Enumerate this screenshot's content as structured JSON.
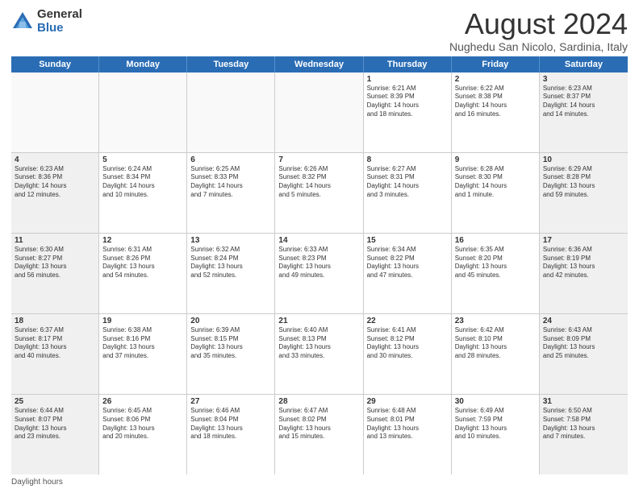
{
  "logo": {
    "general": "General",
    "blue": "Blue"
  },
  "title": "August 2024",
  "location": "Nughedu San Nicolo, Sardinia, Italy",
  "days": [
    "Sunday",
    "Monday",
    "Tuesday",
    "Wednesday",
    "Thursday",
    "Friday",
    "Saturday"
  ],
  "footer": {
    "daylight": "Daylight hours"
  },
  "weeks": [
    [
      {
        "day": "",
        "info": ""
      },
      {
        "day": "",
        "info": ""
      },
      {
        "day": "",
        "info": ""
      },
      {
        "day": "",
        "info": ""
      },
      {
        "day": "1",
        "info": "Sunrise: 6:21 AM\nSunset: 8:39 PM\nDaylight: 14 hours\nand 18 minutes."
      },
      {
        "day": "2",
        "info": "Sunrise: 6:22 AM\nSunset: 8:38 PM\nDaylight: 14 hours\nand 16 minutes."
      },
      {
        "day": "3",
        "info": "Sunrise: 6:23 AM\nSunset: 8:37 PM\nDaylight: 14 hours\nand 14 minutes."
      }
    ],
    [
      {
        "day": "4",
        "info": "Sunrise: 6:23 AM\nSunset: 8:36 PM\nDaylight: 14 hours\nand 12 minutes."
      },
      {
        "day": "5",
        "info": "Sunrise: 6:24 AM\nSunset: 8:34 PM\nDaylight: 14 hours\nand 10 minutes."
      },
      {
        "day": "6",
        "info": "Sunrise: 6:25 AM\nSunset: 8:33 PM\nDaylight: 14 hours\nand 7 minutes."
      },
      {
        "day": "7",
        "info": "Sunrise: 6:26 AM\nSunset: 8:32 PM\nDaylight: 14 hours\nand 5 minutes."
      },
      {
        "day": "8",
        "info": "Sunrise: 6:27 AM\nSunset: 8:31 PM\nDaylight: 14 hours\nand 3 minutes."
      },
      {
        "day": "9",
        "info": "Sunrise: 6:28 AM\nSunset: 8:30 PM\nDaylight: 14 hours\nand 1 minute."
      },
      {
        "day": "10",
        "info": "Sunrise: 6:29 AM\nSunset: 8:28 PM\nDaylight: 13 hours\nand 59 minutes."
      }
    ],
    [
      {
        "day": "11",
        "info": "Sunrise: 6:30 AM\nSunset: 8:27 PM\nDaylight: 13 hours\nand 56 minutes."
      },
      {
        "day": "12",
        "info": "Sunrise: 6:31 AM\nSunset: 8:26 PM\nDaylight: 13 hours\nand 54 minutes."
      },
      {
        "day": "13",
        "info": "Sunrise: 6:32 AM\nSunset: 8:24 PM\nDaylight: 13 hours\nand 52 minutes."
      },
      {
        "day": "14",
        "info": "Sunrise: 6:33 AM\nSunset: 8:23 PM\nDaylight: 13 hours\nand 49 minutes."
      },
      {
        "day": "15",
        "info": "Sunrise: 6:34 AM\nSunset: 8:22 PM\nDaylight: 13 hours\nand 47 minutes."
      },
      {
        "day": "16",
        "info": "Sunrise: 6:35 AM\nSunset: 8:20 PM\nDaylight: 13 hours\nand 45 minutes."
      },
      {
        "day": "17",
        "info": "Sunrise: 6:36 AM\nSunset: 8:19 PM\nDaylight: 13 hours\nand 42 minutes."
      }
    ],
    [
      {
        "day": "18",
        "info": "Sunrise: 6:37 AM\nSunset: 8:17 PM\nDaylight: 13 hours\nand 40 minutes."
      },
      {
        "day": "19",
        "info": "Sunrise: 6:38 AM\nSunset: 8:16 PM\nDaylight: 13 hours\nand 37 minutes."
      },
      {
        "day": "20",
        "info": "Sunrise: 6:39 AM\nSunset: 8:15 PM\nDaylight: 13 hours\nand 35 minutes."
      },
      {
        "day": "21",
        "info": "Sunrise: 6:40 AM\nSunset: 8:13 PM\nDaylight: 13 hours\nand 33 minutes."
      },
      {
        "day": "22",
        "info": "Sunrise: 6:41 AM\nSunset: 8:12 PM\nDaylight: 13 hours\nand 30 minutes."
      },
      {
        "day": "23",
        "info": "Sunrise: 6:42 AM\nSunset: 8:10 PM\nDaylight: 13 hours\nand 28 minutes."
      },
      {
        "day": "24",
        "info": "Sunrise: 6:43 AM\nSunset: 8:09 PM\nDaylight: 13 hours\nand 25 minutes."
      }
    ],
    [
      {
        "day": "25",
        "info": "Sunrise: 6:44 AM\nSunset: 8:07 PM\nDaylight: 13 hours\nand 23 minutes."
      },
      {
        "day": "26",
        "info": "Sunrise: 6:45 AM\nSunset: 8:06 PM\nDaylight: 13 hours\nand 20 minutes."
      },
      {
        "day": "27",
        "info": "Sunrise: 6:46 AM\nSunset: 8:04 PM\nDaylight: 13 hours\nand 18 minutes."
      },
      {
        "day": "28",
        "info": "Sunrise: 6:47 AM\nSunset: 8:02 PM\nDaylight: 13 hours\nand 15 minutes."
      },
      {
        "day": "29",
        "info": "Sunrise: 6:48 AM\nSunset: 8:01 PM\nDaylight: 13 hours\nand 13 minutes."
      },
      {
        "day": "30",
        "info": "Sunrise: 6:49 AM\nSunset: 7:59 PM\nDaylight: 13 hours\nand 10 minutes."
      },
      {
        "day": "31",
        "info": "Sunrise: 6:50 AM\nSunset: 7:58 PM\nDaylight: 13 hours\nand 7 minutes."
      }
    ]
  ]
}
